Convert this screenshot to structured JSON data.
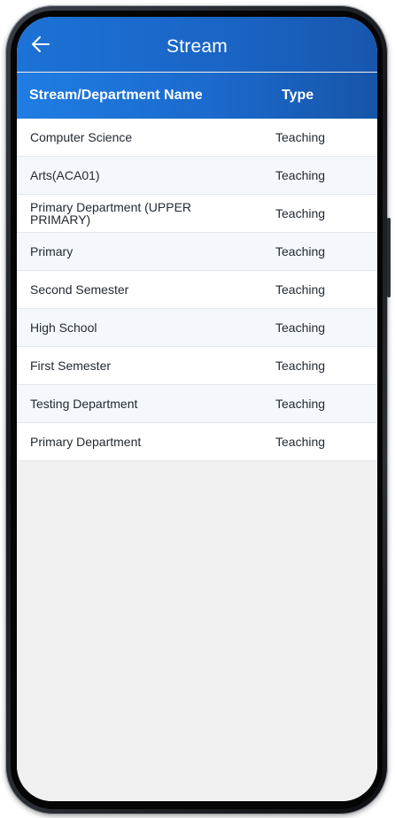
{
  "appbar": {
    "title": "Stream",
    "back_icon": "arrow-left-icon"
  },
  "table": {
    "headers": {
      "name": "Stream/Department Name",
      "type": "Type"
    },
    "rows": [
      {
        "name": "Computer Science",
        "type": "Teaching"
      },
      {
        "name": "Arts(ACA01)",
        "type": "Teaching"
      },
      {
        "name": "Primary Department (UPPER PRIMARY)",
        "type": "Teaching"
      },
      {
        "name": "Primary",
        "type": "Teaching"
      },
      {
        "name": "Second Semester",
        "type": "Teaching"
      },
      {
        "name": "High School",
        "type": "Teaching"
      },
      {
        "name": "First Semester",
        "type": "Teaching"
      },
      {
        "name": "Testing Department",
        "type": "Teaching"
      },
      {
        "name": "Primary Department",
        "type": "Teaching"
      }
    ]
  },
  "colors": {
    "appbar": "#1a64c4",
    "header": "#1b69cc",
    "row_alt": "#f4f8fc",
    "background": "#f0f0f0"
  }
}
